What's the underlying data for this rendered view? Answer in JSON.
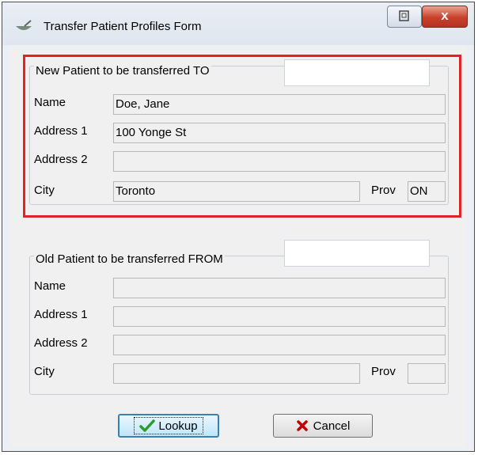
{
  "window": {
    "title": "Transfer Patient Profiles Form",
    "close_glyph": "x"
  },
  "new_patient": {
    "legend": "New Patient to be transferred TO",
    "id_value": "",
    "name_label": "Name",
    "name_value": "Doe, Jane",
    "address1_label": "Address 1",
    "address1_value": "100 Yonge St",
    "address2_label": "Address 2",
    "address2_value": "",
    "city_label": "City",
    "city_value": "Toronto",
    "prov_label": "Prov",
    "prov_value": "ON"
  },
  "old_patient": {
    "legend": "Old Patient to be transferred FROM",
    "id_value": "",
    "name_label": "Name",
    "name_value": "",
    "address1_label": "Address 1",
    "address1_value": "",
    "address2_label": "Address 2",
    "address2_value": "",
    "city_label": "City",
    "city_value": "",
    "prov_label": "Prov",
    "prov_value": ""
  },
  "buttons": {
    "lookup_label": "Lookup",
    "cancel_label": "Cancel",
    "lookup_icon": "checkmark-icon",
    "cancel_icon": "x-icon"
  },
  "colors": {
    "highlight": "#e2222a",
    "lookup_check": "#2e9b2e",
    "cancel_x": "#c00000"
  }
}
